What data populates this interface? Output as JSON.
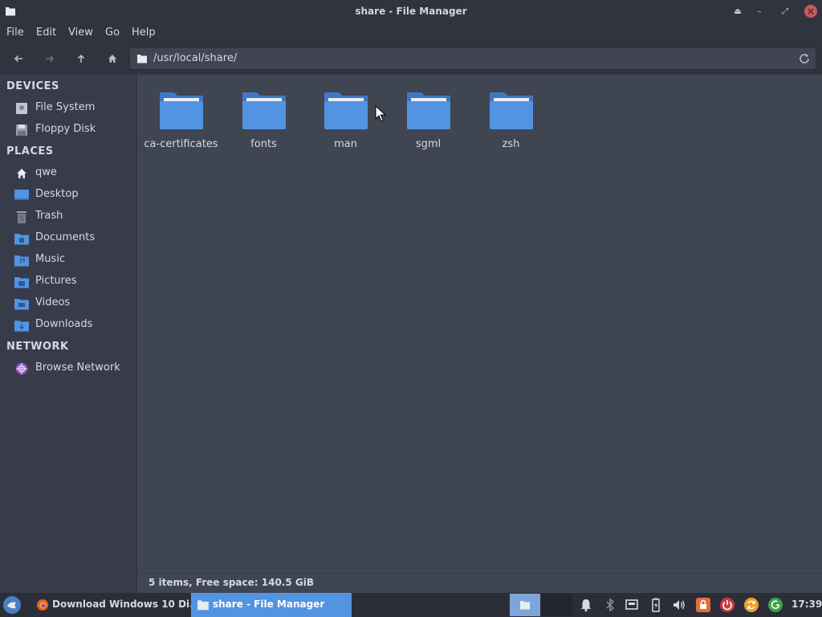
{
  "window": {
    "title": "share - File Manager",
    "controls": [
      "eject-icon",
      "minimize-icon",
      "maximize-icon",
      "close-icon"
    ]
  },
  "menubar": {
    "file": "File",
    "edit": "Edit",
    "view": "View",
    "go": "Go",
    "help": "Help"
  },
  "toolbar": {
    "location": "/usr/local/share/"
  },
  "sidebar": {
    "devices_header": "DEVICES",
    "places_header": "PLACES",
    "network_header": "NETWORK",
    "devices": [
      {
        "label": "File System",
        "icon": "harddisk-icon"
      },
      {
        "label": "Floppy Disk",
        "icon": "floppy-icon"
      }
    ],
    "places": [
      {
        "label": "qwe",
        "icon": "home-icon"
      },
      {
        "label": "Desktop",
        "icon": "desktop-icon"
      },
      {
        "label": "Trash",
        "icon": "trash-icon"
      },
      {
        "label": "Documents",
        "icon": "documents-folder-icon"
      },
      {
        "label": "Music",
        "icon": "music-folder-icon"
      },
      {
        "label": "Pictures",
        "icon": "pictures-folder-icon"
      },
      {
        "label": "Videos",
        "icon": "videos-folder-icon"
      },
      {
        "label": "Downloads",
        "icon": "downloads-folder-icon"
      }
    ],
    "network": [
      {
        "label": "Browse Network",
        "icon": "network-icon"
      }
    ]
  },
  "files": [
    {
      "name": "ca-certificates"
    },
    {
      "name": "fonts"
    },
    {
      "name": "man"
    },
    {
      "name": "sgml"
    },
    {
      "name": "zsh"
    }
  ],
  "statusbar": {
    "text": "5 items, Free space: 140.5 GiB"
  },
  "taskbar": {
    "tasks": [
      {
        "label": "Download Windows 10 Di...",
        "icon": "firefox-icon",
        "active": false
      },
      {
        "label": "share - File Manager",
        "icon": "folder-icon",
        "active": true
      }
    ],
    "clock": "17:39"
  },
  "colors": {
    "accent": "#5294e2",
    "folder": "#5294e2",
    "close": "#cc575d",
    "background": "#404552",
    "sidebar": "#383c4a"
  }
}
